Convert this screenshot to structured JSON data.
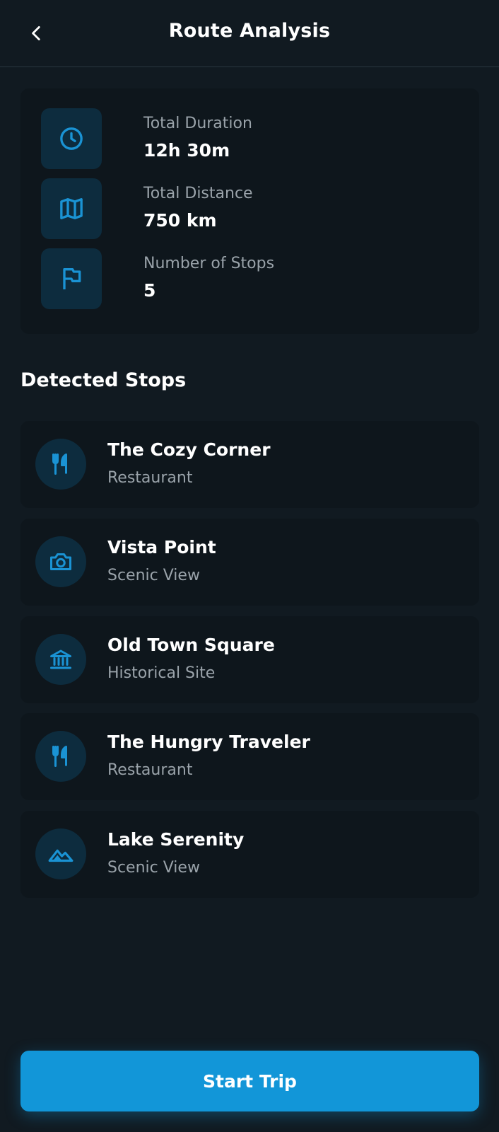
{
  "header": {
    "title": "Route Analysis",
    "back_icon": "chevron-left-icon"
  },
  "summary": [
    {
      "icon": "clock-icon",
      "label": "Total Duration",
      "value": "12h 30m"
    },
    {
      "icon": "map-icon",
      "label": "Total Distance",
      "value": "750 km"
    },
    {
      "icon": "flag-icon",
      "label": "Number of Stops",
      "value": "5"
    }
  ],
  "stops_section": {
    "title": "Detected Stops",
    "items": [
      {
        "name": "The Cozy Corner",
        "type": "Restaurant",
        "icon": "restaurant-icon"
      },
      {
        "name": "Vista Point",
        "type": "Scenic View",
        "icon": "camera-icon"
      },
      {
        "name": "Old Town Square",
        "type": "Historical Site",
        "icon": "museum-icon"
      },
      {
        "name": "The Hungry Traveler",
        "type": "Restaurant",
        "icon": "restaurant-icon"
      },
      {
        "name": "Lake Serenity",
        "type": "Scenic View",
        "icon": "landscape-icon"
      }
    ]
  },
  "footer": {
    "start_label": "Start Trip"
  },
  "colors": {
    "background": "#111a21",
    "card": "#0e161c",
    "icon_bg": "#0d2c3e",
    "accent": "#1296d8",
    "muted_text": "#9aa3aa"
  }
}
